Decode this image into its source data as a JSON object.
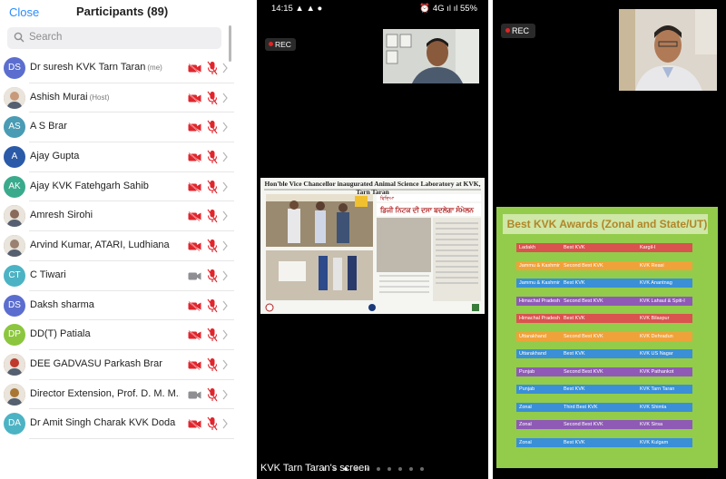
{
  "participants_panel": {
    "close_label": "Close",
    "title": "Participants (89)",
    "search_placeholder": "Search",
    "participants": [
      {
        "initials": "DS",
        "name": "Dr suresh KVK Tarn Taran",
        "tag": "(me)",
        "avatar_color": "#5b6ecf",
        "video": "off",
        "audio": "muted"
      },
      {
        "initials": "",
        "name": "Ashish Murai",
        "tag": "(Host)",
        "avatar_color": "#c89a7a",
        "video": "off",
        "audio": "muted"
      },
      {
        "initials": "AS",
        "name": "A S Brar",
        "tag": "",
        "avatar_color": "#4a9bb4",
        "video": "off",
        "audio": "muted"
      },
      {
        "initials": "A",
        "name": "Ajay Gupta",
        "tag": "",
        "avatar_color": "#2b5aa8",
        "video": "off",
        "audio": "muted"
      },
      {
        "initials": "AK",
        "name": "Ajay KVK Fatehgarh Sahib",
        "tag": "",
        "avatar_color": "#3aaa8c",
        "video": "off",
        "audio": "muted"
      },
      {
        "initials": "",
        "name": "Amresh Sirohi",
        "tag": "",
        "avatar_color": "#8a6a5a",
        "video": "off",
        "audio": "muted"
      },
      {
        "initials": "",
        "name": "Arvind Kumar, ATARI, Ludhiana",
        "tag": "",
        "avatar_color": "#9a8070",
        "video": "off",
        "audio": "muted"
      },
      {
        "initials": "CT",
        "name": "C Tiwari",
        "tag": "",
        "avatar_color": "#4cb3c4",
        "video": "on",
        "audio": "muted"
      },
      {
        "initials": "DS",
        "name": "Daksh sharma",
        "tag": "",
        "avatar_color": "#5b6ecf",
        "video": "off",
        "audio": "muted"
      },
      {
        "initials": "DP",
        "name": "DD(T) Patiala",
        "tag": "",
        "avatar_color": "#8cc63e",
        "video": "off",
        "audio": "muted"
      },
      {
        "initials": "",
        "name": "DEE GADVASU Parkash Brar",
        "tag": "",
        "avatar_color": "#c0392b",
        "video": "off",
        "audio": "muted"
      },
      {
        "initials": "",
        "name": "Director Extension, Prof. D. M. M...",
        "tag": "",
        "avatar_color": "#aa7733",
        "video": "on",
        "audio": "muted"
      },
      {
        "initials": "DA",
        "name": "Dr Amit Singh Charak KVK Doda",
        "tag": "",
        "avatar_color": "#4cb3c4",
        "video": "off",
        "audio": "muted"
      }
    ]
  },
  "screen_share_panel": {
    "time": "14:15",
    "status_icons": "▲ ▲ ●",
    "status_right": "⏰ 4G ıl ıl 55%",
    "rec_label": "REC",
    "newspaper_headline": "Hon'ble Vice Chancellor inaugurated Animal Science Laboratory at KVK, Tarn Taran",
    "share_label": "KVK Tarn Taran's screen",
    "page_count": 10,
    "active_page": 2
  },
  "awards_panel": {
    "rec_label": "REC",
    "title": "Best KVK Awards (Zonal and State/UT)",
    "rows": [
      {
        "region": "Ladakh",
        "award": "Best KVK",
        "kvk": "Kargil-I",
        "color": "#d9534f"
      },
      {
        "region": "Jammu & Kashmir",
        "award": "Second Best KVK",
        "kvk": "KVK Reasi",
        "color": "#f0a23a"
      },
      {
        "region": "Jammu & Kashmir",
        "award": "Best KVK",
        "kvk": "KVK Anantnag",
        "color": "#3a8fd6"
      },
      {
        "region": "Himachal Pradesh",
        "award": "Second Best KVK",
        "kvk": "KVK Lahaul & Spiti-I",
        "color": "#8e5ab5"
      },
      {
        "region": "Himachal Pradesh",
        "award": "Best KVK",
        "kvk": "KVK Bilaspur",
        "color": "#d9534f"
      },
      {
        "region": "Uttarakhand",
        "award": "Second Best KVK",
        "kvk": "KVK Dehradun",
        "color": "#f0a23a"
      },
      {
        "region": "Uttarakhand",
        "award": "Best KVK",
        "kvk": "KVK US Nagar",
        "color": "#3a8fd6"
      },
      {
        "region": "Punjab",
        "award": "Second Best KVK",
        "kvk": "KVK Pathankot",
        "color": "#8e5ab5"
      },
      {
        "region": "Punjab",
        "award": "Best KVK",
        "kvk": "KVK Tarn Taran",
        "color": "#3a8fd6"
      },
      {
        "region": "Zonal",
        "award": "Third Best KVK",
        "kvk": "KVK Shimla",
        "color": "#3a8fd6"
      },
      {
        "region": "Zonal",
        "award": "Second Best KVK",
        "kvk": "KVK Sirsa",
        "color": "#8e5ab5"
      },
      {
        "region": "Zonal",
        "award": "Best KVK",
        "kvk": "KVK Kulgam",
        "color": "#3a8fd6"
      }
    ]
  }
}
